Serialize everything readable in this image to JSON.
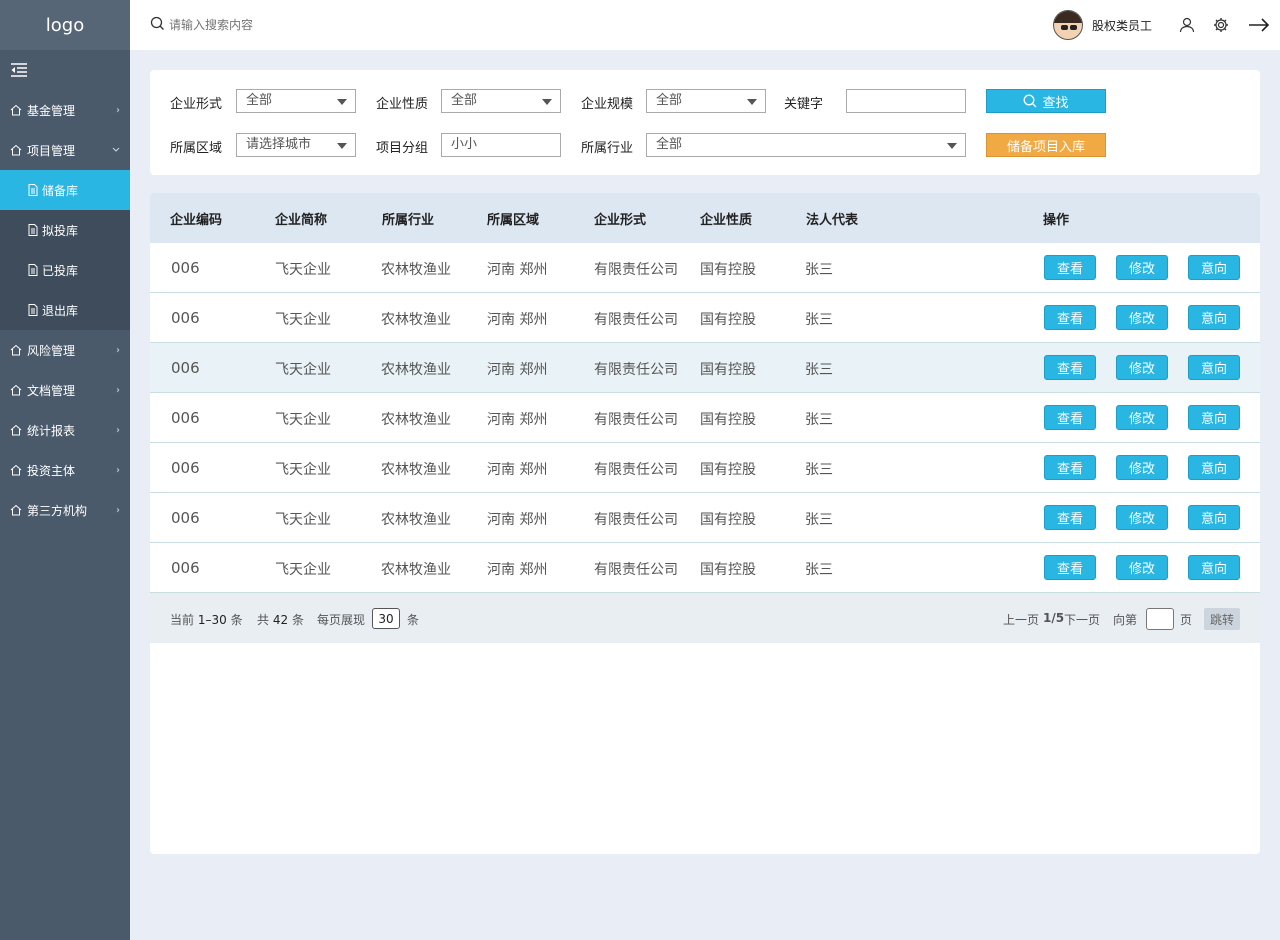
{
  "sidebar": {
    "logo": "logo",
    "menu": [
      {
        "label": "基金管理",
        "icon": "home-icon"
      },
      {
        "label": "项目管理",
        "icon": "home-icon"
      },
      {
        "label": "风险管理",
        "icon": "home-icon"
      },
      {
        "label": "文档管理",
        "icon": "home-icon"
      },
      {
        "label": "统计报表",
        "icon": "home-icon"
      },
      {
        "label": "投资主体",
        "icon": "home-icon"
      },
      {
        "label": "第三方机构",
        "icon": "home-icon"
      }
    ],
    "submenu": [
      {
        "label": "储备库",
        "active": true
      },
      {
        "label": "拟投库"
      },
      {
        "label": "已投库"
      },
      {
        "label": "退出库"
      }
    ]
  },
  "topbar": {
    "search_placeholder": "请输入搜索内容",
    "username": "股权类员工"
  },
  "filter": {
    "form_label": "企业形式",
    "form_value": "全部",
    "nature_label": "企业性质",
    "nature_value": "全部",
    "scale_label": "企业规模",
    "scale_value": "全部",
    "keyword_label": "关键字",
    "keyword_value": "",
    "find_button": "查找",
    "region_label": "所属区域",
    "region_placeholder": "请选择城市",
    "group_label": "项目分组",
    "group_value": "小小",
    "industry_label": "所属行业",
    "industry_value": "全部",
    "store_button": "储备项目入库"
  },
  "table": {
    "headers": [
      "企业编码",
      "企业简称",
      "所属行业",
      "所属区域",
      "企业形式",
      "企业性质",
      "法人代表",
      "操作"
    ],
    "actions": {
      "view": "查看",
      "edit": "修改",
      "intent": "意向"
    },
    "rows": [
      {
        "code": "006",
        "name": "飞天企业",
        "industry": "农林牧渔业",
        "region": "河南 郑州",
        "form": "有限责任公司",
        "nature": "国有控股",
        "legal": "张三"
      },
      {
        "code": "006",
        "name": "飞天企业",
        "industry": "农林牧渔业",
        "region": "河南 郑州",
        "form": "有限责任公司",
        "nature": "国有控股",
        "legal": "张三"
      },
      {
        "code": "006",
        "name": "飞天企业",
        "industry": "农林牧渔业",
        "region": "河南 郑州",
        "form": "有限责任公司",
        "nature": "国有控股",
        "legal": "张三"
      },
      {
        "code": "006",
        "name": "飞天企业",
        "industry": "农林牧渔业",
        "region": "河南 郑州",
        "form": "有限责任公司",
        "nature": "国有控股",
        "legal": "张三"
      },
      {
        "code": "006",
        "name": "飞天企业",
        "industry": "农林牧渔业",
        "region": "河南 郑州",
        "form": "有限责任公司",
        "nature": "国有控股",
        "legal": "张三"
      },
      {
        "code": "006",
        "name": "飞天企业",
        "industry": "农林牧渔业",
        "region": "河南 郑州",
        "form": "有限责任公司",
        "nature": "国有控股",
        "legal": "张三"
      },
      {
        "code": "006",
        "name": "飞天企业",
        "industry": "农林牧渔业",
        "region": "河南 郑州",
        "form": "有限责任公司",
        "nature": "国有控股",
        "legal": "张三"
      }
    ]
  },
  "pager": {
    "current_prefix": "当前",
    "current_range": "1–30",
    "current_suffix": "条",
    "total_prefix": "共",
    "total": "42",
    "total_suffix": "条",
    "per_page_prefix": "每页展现",
    "per_page": "30",
    "per_page_suffix": "条",
    "prev": "上一页",
    "page_info": "1/5",
    "next": "下一页",
    "goto_prefix": "向第",
    "goto_suffix": "页",
    "jump": "跳转"
  },
  "colors": {
    "accent": "#29b6e3",
    "warning": "#f1a944",
    "sidebar": "#4a5a6b"
  }
}
